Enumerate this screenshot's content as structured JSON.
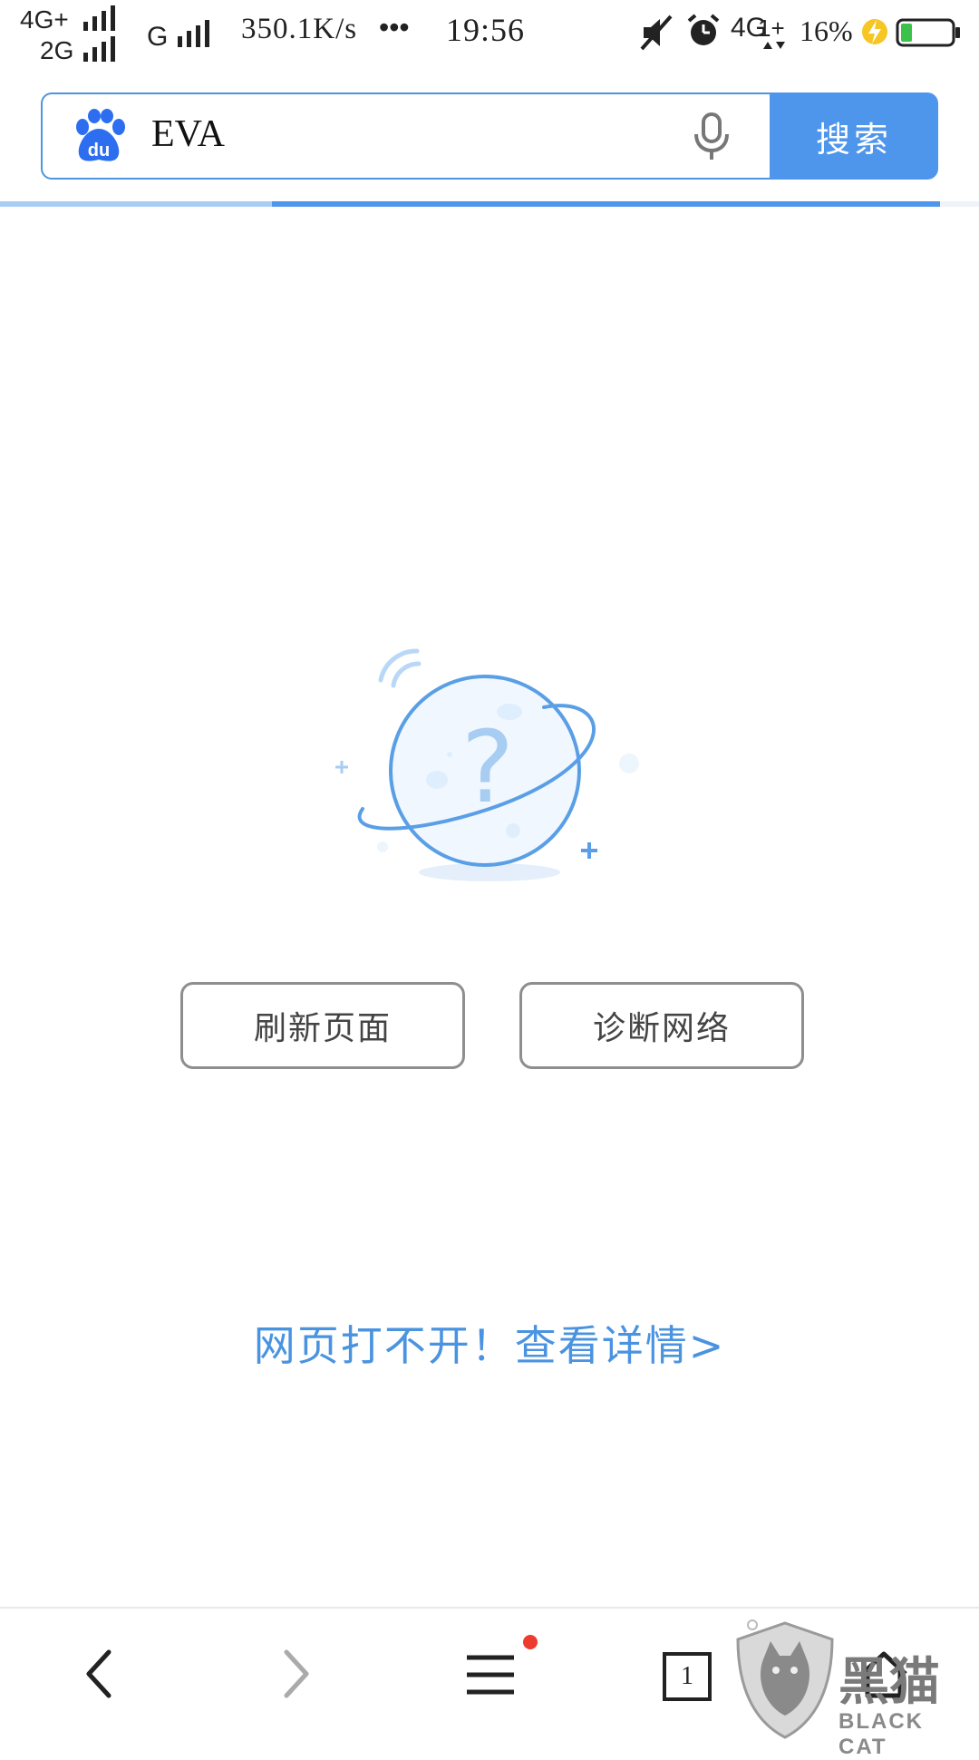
{
  "status_bar": {
    "network_1": "4G+",
    "network_2": "2G",
    "network_3": "G",
    "speed": "350.1K/s",
    "more": "•••",
    "time": "19:56",
    "network_4": "4G",
    "battery_percent": "16%",
    "icons": [
      "mute-icon",
      "alarm-icon",
      "charging-icon",
      "battery-icon"
    ]
  },
  "search": {
    "value": "EVA",
    "button_label": "搜索",
    "logo_text": "du",
    "icons": [
      "baidu-paw-logo",
      "mic-icon"
    ]
  },
  "progress": {
    "value": 0.96
  },
  "error_page": {
    "refresh_label": "刷新页面",
    "diagnose_label": "诊断网络",
    "detail_link": "网页打不开！查看详情>",
    "illustration": "planet-question-icon"
  },
  "bottom_nav": {
    "tab_count": "1",
    "icons": [
      "back-icon",
      "forward-icon",
      "menu-icon",
      "tabs-icon",
      "home-icon"
    ]
  },
  "watermark": {
    "text": "黑猫",
    "sub": "BLACK CAT"
  },
  "colors": {
    "accent": "#4e95ec",
    "link": "#4a93e0",
    "badge": "#ee3b30"
  }
}
